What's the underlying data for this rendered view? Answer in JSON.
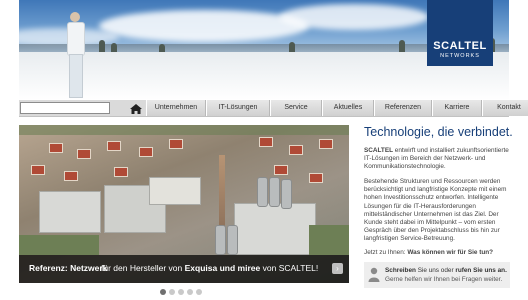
{
  "header": {
    "logo_name": "SCALTEL",
    "logo_sub": "NETWORKS"
  },
  "nav": {
    "search_value": "",
    "tabs": [
      "Unternehmen",
      "IT-Lösungen",
      "Service",
      "Aktuelles",
      "Referenzen",
      "Karriere",
      "Kontakt"
    ]
  },
  "slider": {
    "caption_bold": "Referenz: Netzwerk",
    "caption_pre": "für den Hersteller von",
    "caption_brand": "Exquisa und miree",
    "caption_mid": "von",
    "caption_end": "SCALTEL!",
    "next_symbol": "›",
    "dots_count": 5,
    "active_dot": 1
  },
  "content": {
    "headline": "Technologie, die verbindet.",
    "p1_bold": "SCALTEL",
    "p1_text": "entwirft und installiert zukunftsorientierte IT-Lösungen im Bereich der Netzwerk- und Kommunikationstechnologie.",
    "p2": "Bestehende Strukturen und Ressourcen werden berücksichtigt und langfristige Konzepte mit einem hohen Investitionsschutz entworfen. Intelligente Lösungen für die IT-Herausforderungen mittelständischer Unternehmen ist das Ziel. Der Kunde steht dabei im Mittelpunkt – vom ersten Gespräch über den Projektabschluss bis hin zur langfristigen Service-Betreuung.",
    "p3_pre": "Jetzt zu Ihnen:",
    "p3_bold": "Was können wir für Sie tun?"
  },
  "contact": {
    "write_bold": "Schreiben",
    "write_text": "Sie uns oder",
    "call_bold": "rufen Sie uns an.",
    "line2": "Gerne helfen wir Ihnen bei Fragen weiter."
  },
  "colors": {
    "brand_blue": "#173f78",
    "nav_gray": "#dadada",
    "caption_bg": "#000000"
  }
}
